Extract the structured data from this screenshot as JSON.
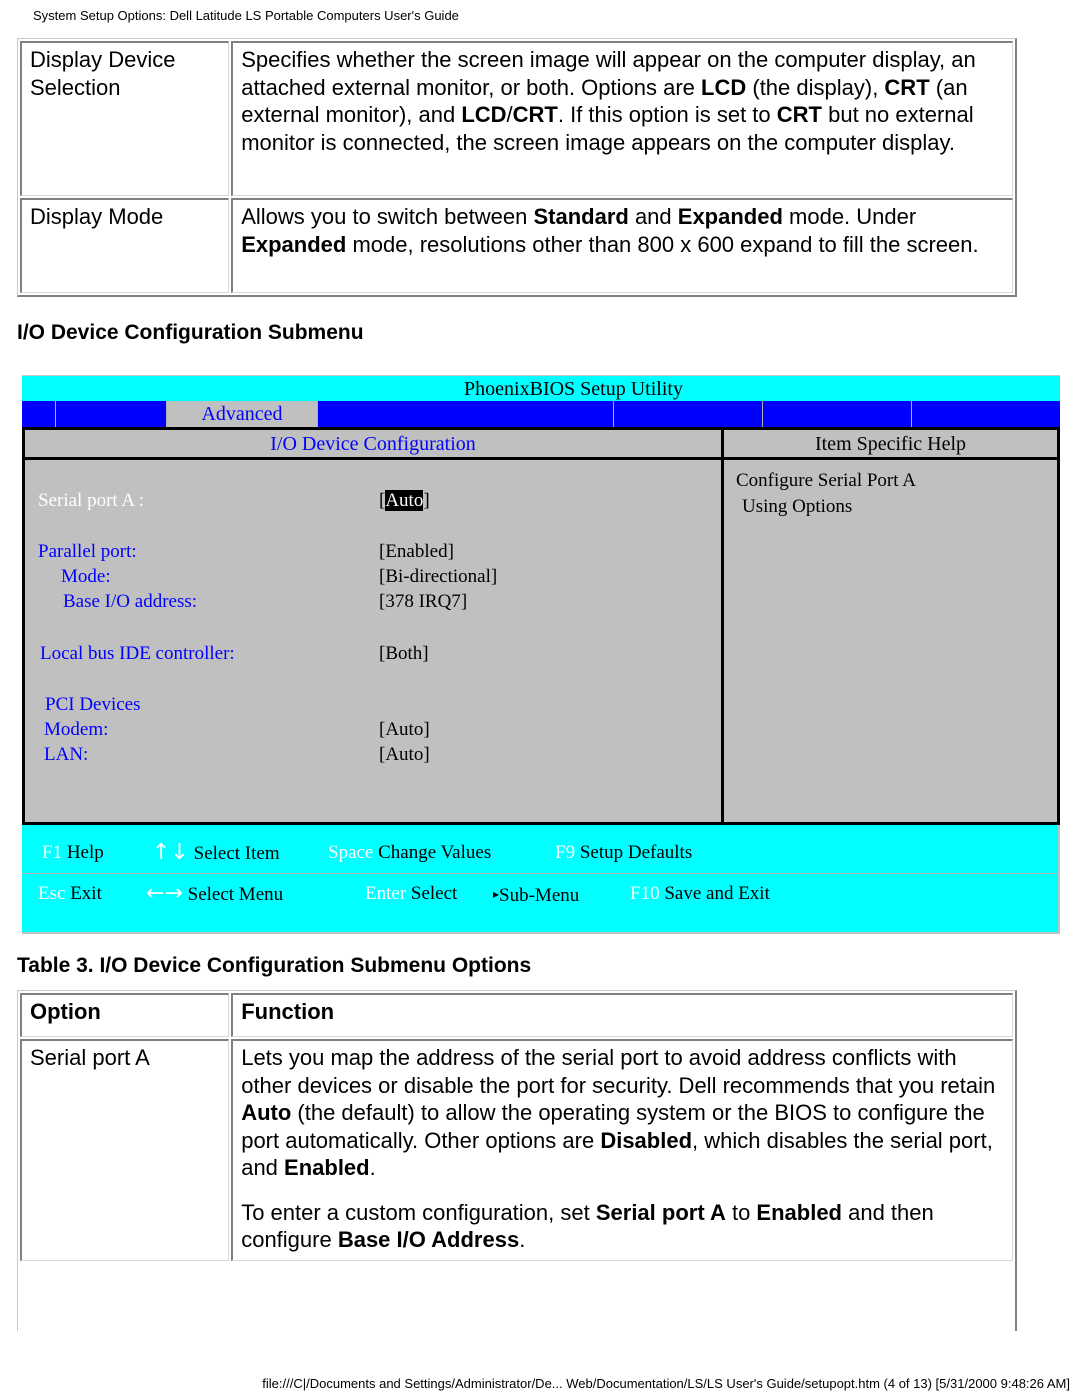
{
  "header": {
    "title": "System Setup Options: Dell Latitude LS Portable Computers User's Guide"
  },
  "table1": {
    "rows": [
      {
        "option": "Display Device Selection",
        "function": [
          {
            "t": "Specifies whether the screen image will appear on the computer display, an attached external monitor, or both. Options are "
          },
          {
            "b": "LCD"
          },
          {
            "t": " (the display), "
          },
          {
            "b": "CRT"
          },
          {
            "t": " (an external monitor), and "
          },
          {
            "b": "LCD"
          },
          {
            "t": "/"
          },
          {
            "b": "CRT"
          },
          {
            "t": ". If this option is set to "
          },
          {
            "b": "CRT"
          },
          {
            "t": " but no external monitor is connected, the screen image appears on the computer display."
          }
        ]
      },
      {
        "option": "Display Mode",
        "function": [
          {
            "t": "Allows you to switch between "
          },
          {
            "b": "Standard"
          },
          {
            "t": " and "
          },
          {
            "b": "Expanded"
          },
          {
            "t": " mode. Under "
          },
          {
            "b": "Expanded"
          },
          {
            "t": " mode, resolutions other than 800 x 600 expand to fill the screen."
          }
        ]
      }
    ]
  },
  "section_heading": "I/O Device Configuration Submenu",
  "bios": {
    "title": "PhoenixBIOS Setup Utility",
    "active_tab": "Advanced",
    "left_header": "I/O Device Configuration",
    "right_header": "Item Specific Help",
    "settings": [
      {
        "label": "Serial port A :",
        "value": "Auto",
        "selected": true
      },
      {
        "label": "Parallel port:",
        "value": "Enabled"
      },
      {
        "label": "Mode:",
        "value": "Bi-directional"
      },
      {
        "label": "Base I/O address:",
        "value": "378 IRQ7"
      },
      {
        "label": "Local bus IDE controller:",
        "value": "Both"
      },
      {
        "label": "PCI Devices",
        "value": ""
      },
      {
        "label": "Modem:",
        "value": "Auto"
      },
      {
        "label": "LAN:",
        "value": "Auto"
      }
    ],
    "help_text": [
      "Configure Serial Port A",
      "Using Options"
    ],
    "footer": {
      "row1": [
        {
          "key": "F1",
          "action": "Help"
        },
        {
          "key": "↑↓",
          "action": "Select Item"
        },
        {
          "key": "Space",
          "action": "Change Values"
        },
        {
          "key": "F9",
          "action": "Setup Defaults"
        }
      ],
      "row2": [
        {
          "key": "Esc",
          "action": "Exit"
        },
        {
          "key": "←→",
          "action": "Select Menu"
        },
        {
          "key": "Enter",
          "action": "Select"
        },
        {
          "key": "▸",
          "action": "Sub-Menu"
        },
        {
          "key": "F10",
          "action": "Save and Exit"
        }
      ]
    },
    "colors": {
      "cyan": "#00ffff",
      "blue": "#0000ff",
      "gray": "#c0c0c0"
    }
  },
  "table3": {
    "caption": "Table 3. I/O Device Configuration Submenu Options",
    "headers": [
      "Option",
      "Function"
    ],
    "rows": [
      {
        "option": "Serial port A",
        "paragraphs": [
          [
            {
              "t": "Lets you map the address of the serial port to avoid address conflicts with other devices or disable the port for security. Dell recommends that you retain "
            },
            {
              "b": "Auto"
            },
            {
              "t": " (the default) to allow the operating system or the BIOS to configure the port automatically. Other options are "
            },
            {
              "b": "Disabled"
            },
            {
              "t": ", which disables the serial port, and "
            },
            {
              "b": "Enabled"
            },
            {
              "t": "."
            }
          ],
          [
            {
              "t": "To enter a custom configuration, set "
            },
            {
              "b": "Serial port A"
            },
            {
              "t": " to "
            },
            {
              "b": "Enabled"
            },
            {
              "t": " and then configure "
            },
            {
              "b": "Base I/O Address"
            },
            {
              "t": "."
            }
          ]
        ]
      }
    ]
  },
  "footer": {
    "text": "file:///C|/Documents and Settings/Administrator/De... Web/Documentation/LS/LS User's Guide/setupopt.htm (4 of 13) [5/31/2000 9:48:26 AM]"
  }
}
